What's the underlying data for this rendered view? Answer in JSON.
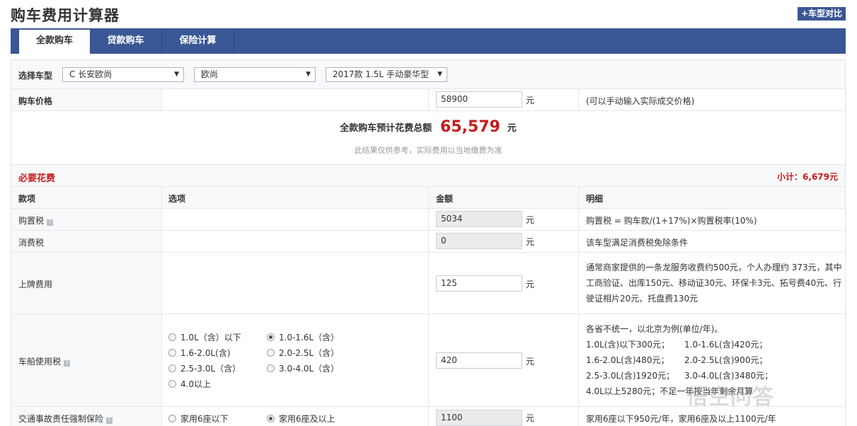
{
  "page_title": "购车费用计算器",
  "compare_button": "+车型对比",
  "tabs": [
    {
      "label": "全款购车",
      "active": true
    },
    {
      "label": "贷款购车",
      "active": false
    },
    {
      "label": "保险计算",
      "active": false
    }
  ],
  "car_select": {
    "label": "选择车型",
    "brand": "C 长安欧尚",
    "series": "欧尚",
    "model": "2017款 1.5L 手动豪华型"
  },
  "price": {
    "label": "购车价格",
    "value": "58900",
    "unit": "元",
    "hint": "(可以手动输入实际成交价格)"
  },
  "total": {
    "label": "全款购车预计花费总额",
    "amount": "65,579",
    "unit": "元",
    "note": "此结果仅供参考，实际费用以当地缴费为准"
  },
  "section": {
    "title": "必要花费",
    "subtotal": "小计：6,679元"
  },
  "table_headers": {
    "item": "款项",
    "option": "选项",
    "amount": "金额",
    "detail": "明细"
  },
  "help_glyph": "?",
  "rows": {
    "purchase_tax": {
      "name": "购置税",
      "value": "5034",
      "unit": "元",
      "detail": "购置税 = 购车款/(1+17%)×购置税率(10%)"
    },
    "consumption_tax": {
      "name": "消费税",
      "value": "0",
      "unit": "元",
      "detail": "该车型满足消费税免除条件"
    },
    "plate_fee": {
      "name": "上牌费用",
      "value": "125",
      "unit": "元",
      "detail_lines": [
        "通常商家提供的一条龙服务收费约500元，个人办理约 373元，其中",
        "工商验证、出库150元、移动证30元、环保卡3元、拓号费40元、行",
        "驶证相片20元、托盘费130元"
      ]
    },
    "vehicle_tax": {
      "name": "车船使用税",
      "value": "420",
      "unit": "元",
      "options": [
        {
          "label": "1.0L（含）以下",
          "checked": false
        },
        {
          "label": "1.0-1.6L（含）",
          "checked": true
        },
        {
          "label": "1.6-2.0L(含)",
          "checked": false
        },
        {
          "label": "2.0-2.5L（含）",
          "checked": false
        },
        {
          "label": "2.5-3.0L（含）",
          "checked": false
        },
        {
          "label": "3.0-4.0L（含）",
          "checked": false
        },
        {
          "label": "4.0以上",
          "checked": false
        }
      ],
      "detail_title": "各省不统一，以北京为例(单位/年)。",
      "detail_grid": [
        [
          "1.0L(含)以下300元；",
          "1.0-1.6L(含)420元；"
        ],
        [
          "1.6-2.0L(含)480元；",
          "2.0-2.5L(含)900元；"
        ],
        [
          "2.5-3.0L(含)1920元；",
          "3.0-4.0L(含)3480元；"
        ],
        [
          "4.0L以上5280元；不足一年按当年剩余月算",
          ""
        ]
      ]
    },
    "insurance": {
      "name": "交通事故责任强制保险",
      "value": "1100",
      "unit": "元",
      "options": [
        {
          "label": "家用6座以下",
          "checked": false
        },
        {
          "label": "家用6座及以上",
          "checked": true
        }
      ],
      "detail": "家用6座以下950元/年，家用6座及以上1100元/年"
    }
  },
  "watermark": "悟空问答"
}
